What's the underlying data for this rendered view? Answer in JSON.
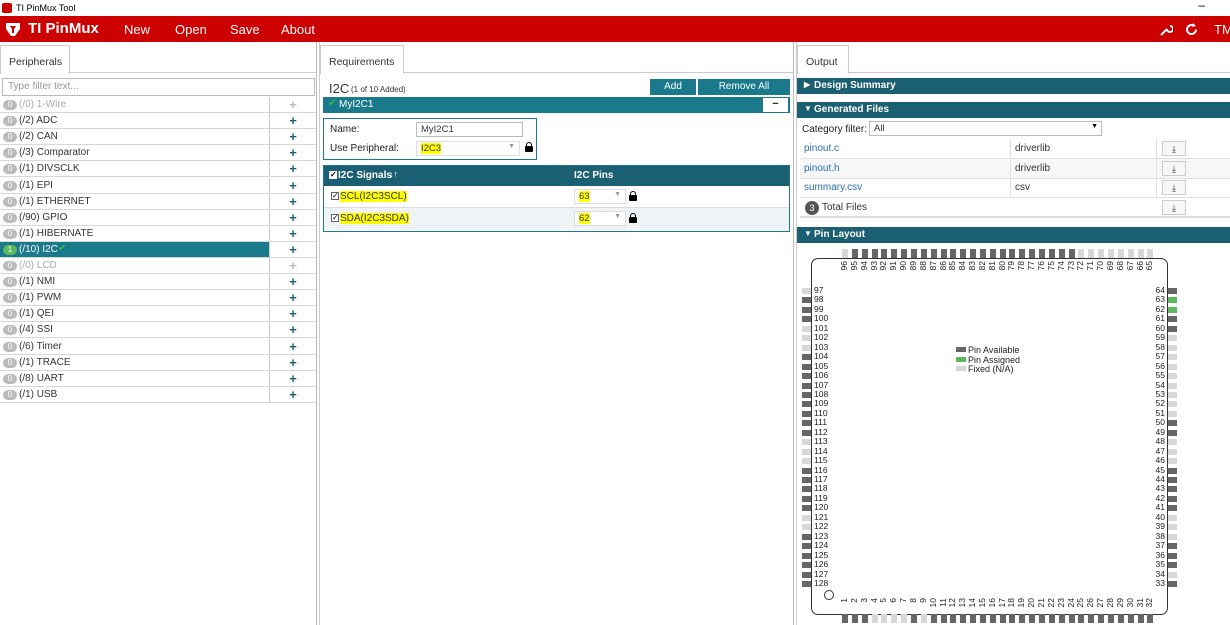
{
  "window": {
    "title": "TI PinMux Tool"
  },
  "menu": {
    "brand": "TI PinMux",
    "items": [
      "New",
      "Open",
      "Save",
      "About"
    ],
    "user": "TM"
  },
  "left": {
    "tab": "Peripherals",
    "filter_placeholder": "Type filter text...",
    "peripherals": [
      {
        "badge": "0",
        "label": "(/0) 1-Wire",
        "disabled": true
      },
      {
        "badge": "0",
        "label": "(/2) ADC"
      },
      {
        "badge": "0",
        "label": "(/2) CAN"
      },
      {
        "badge": "0",
        "label": "(/3) Comparator"
      },
      {
        "badge": "0",
        "label": "(/1) DIVSCLK"
      },
      {
        "badge": "0",
        "label": "(/1) EPI"
      },
      {
        "badge": "0",
        "label": "(/1) ETHERNET"
      },
      {
        "badge": "0",
        "label": "(/90) GPIO"
      },
      {
        "badge": "0",
        "label": "(/1) HIBERNATE"
      },
      {
        "badge": "1",
        "label": "(/10) I2C",
        "selected": true,
        "check": "✔"
      },
      {
        "badge": "0",
        "label": "(/0) LCD",
        "disabled": true
      },
      {
        "badge": "0",
        "label": "(/1) NMI"
      },
      {
        "badge": "0",
        "label": "(/1) PWM"
      },
      {
        "badge": "0",
        "label": "(/1) QEI"
      },
      {
        "badge": "0",
        "label": "(/4) SSI"
      },
      {
        "badge": "0",
        "label": "(/6) Timer"
      },
      {
        "badge": "0",
        "label": "(/1) TRACE"
      },
      {
        "badge": "0",
        "label": "(/8) UART"
      },
      {
        "badge": "0",
        "label": "(/1) USB"
      }
    ]
  },
  "mid": {
    "tab": "Requirements",
    "heading": "I2C",
    "subheading": "(1 of 10 Added)",
    "add_label": "Add",
    "remove_all_label": "Remove All",
    "instance_name": "MyI2C1",
    "minus": "−",
    "name_label": "Name:",
    "name_value": "MyI2C1",
    "use_periph_label": "Use Peripheral:",
    "use_periph_value": "I2C3",
    "signals_header": "I2C Signals",
    "sort_glyph": "↓↑",
    "pins_header": "I2C Pins",
    "signals": [
      {
        "name": "SCL(I2C3SCL)",
        "pin": "63"
      },
      {
        "name": "SDA(I2C3SDA)",
        "pin": "62"
      }
    ]
  },
  "right": {
    "tab": "Output",
    "design_summary": "Design Summary",
    "generated_files": "Generated Files",
    "category_label": "Category filter:",
    "category_value": "All",
    "files": [
      {
        "name": "pinout.c",
        "type": "driverlib"
      },
      {
        "name": "pinout.h",
        "type": "driverlib"
      },
      {
        "name": "summary.csv",
        "type": "csv"
      }
    ],
    "total_count": "3",
    "total_label": "Total Files",
    "pin_layout": "Pin Layout",
    "legend": [
      "Pin Available",
      "Pin Assigned",
      "Fixed (N/A)"
    ],
    "colors": {
      "available": "#666666",
      "assigned": "#5cb85c",
      "fixed": "#d8d8d8"
    },
    "pins": {
      "top": [
        "96",
        "95",
        "94",
        "93",
        "92",
        "91",
        "90",
        "89",
        "88",
        "87",
        "86",
        "85",
        "84",
        "83",
        "82",
        "81",
        "80",
        "79",
        "78",
        "77",
        "76",
        "75",
        "74",
        "73",
        "72",
        "71",
        "70",
        "69",
        "68",
        "67",
        "66",
        "65"
      ],
      "left": [
        "97",
        "98",
        "99",
        "100",
        "101",
        "102",
        "103",
        "104",
        "105",
        "106",
        "107",
        "108",
        "109",
        "110",
        "111",
        "112",
        "113",
        "114",
        "115",
        "116",
        "117",
        "118",
        "119",
        "120",
        "121",
        "122",
        "123",
        "124",
        "125",
        "126",
        "127",
        "128"
      ],
      "right": [
        "64",
        "63",
        "62",
        "61",
        "60",
        "59",
        "58",
        "57",
        "56",
        "55",
        "54",
        "53",
        "52",
        "51",
        "50",
        "49",
        "48",
        "47",
        "46",
        "45",
        "44",
        "43",
        "42",
        "41",
        "40",
        "39",
        "38",
        "37",
        "36",
        "35",
        "34",
        "33"
      ],
      "bottom": [
        "1",
        "2",
        "3",
        "4",
        "5",
        "6",
        "7",
        "8",
        "9",
        "10",
        "11",
        "12",
        "13",
        "14",
        "15",
        "16",
        "17",
        "18",
        "19",
        "20",
        "21",
        "22",
        "23",
        "24",
        "25",
        "26",
        "27",
        "28",
        "29",
        "30",
        "31",
        "32"
      ],
      "assigned": [
        "63",
        "62"
      ],
      "fixed": [
        "65",
        "66",
        "67",
        "68",
        "69",
        "70",
        "71",
        "72",
        "96",
        "97",
        "101",
        "102",
        "103",
        "113",
        "114",
        "115",
        "121",
        "122",
        "59",
        "58",
        "57",
        "56",
        "55",
        "54",
        "53",
        "52",
        "51",
        "48",
        "47",
        "46",
        "40",
        "39",
        "38",
        "34",
        "4",
        "5",
        "6",
        "7",
        "9"
      ]
    }
  }
}
